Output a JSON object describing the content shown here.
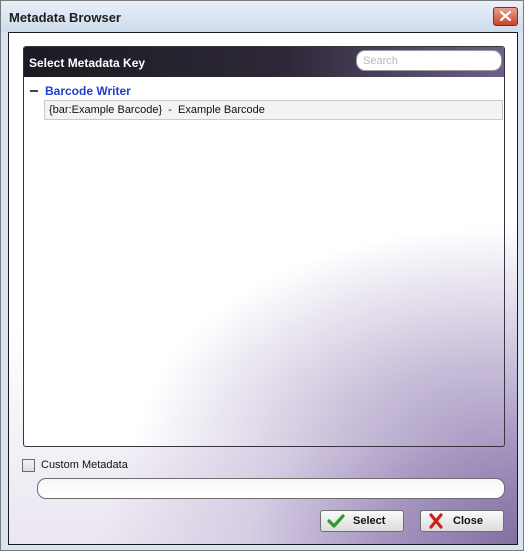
{
  "window": {
    "title": "Metadata Browser"
  },
  "panel": {
    "title": "Select Metadata Key",
    "search_placeholder": "Search"
  },
  "tree": {
    "groups": [
      {
        "label": "Barcode Writer",
        "expanded": true,
        "items": [
          {
            "label": "{bar:Example Barcode}  -  Example Barcode"
          }
        ]
      }
    ]
  },
  "custom": {
    "checkbox_label": "Custom Metadata",
    "checked": false,
    "value": ""
  },
  "buttons": {
    "select_label": "Select",
    "close_label": "Close"
  },
  "colors": {
    "group_label": "#1f3fd0",
    "panel_header": "#1c1a22",
    "select_icon": "#2e9a2e",
    "close_icon": "#cc1f1f"
  }
}
